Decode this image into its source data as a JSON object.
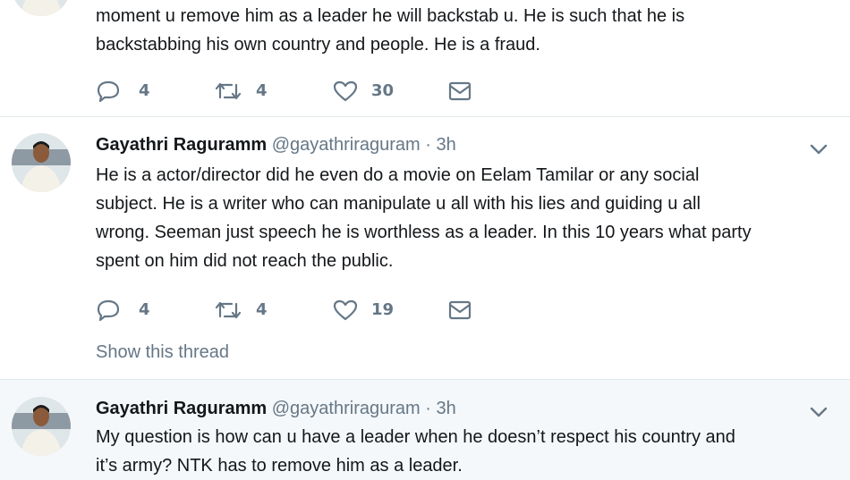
{
  "tweets": [
    {
      "text_lines": [
        "moment u remove him as a leader he will backstab u. He is such that he is",
        "backstabbing his own country and people. He is a fraud."
      ],
      "replies": "4",
      "retweets": "4",
      "likes": "30"
    },
    {
      "name": "Gayathri Raguramm",
      "handle": "@gayathriraguram",
      "separator": "·",
      "time": "3h",
      "text_lines": [
        "He is a actor/director did he even do a movie on Eelam Tamilar or any social",
        "subject. He is a writer who can manipulate u all with his lies and guiding u all",
        "wrong. Seeman just speech he is worthless as a leader. In this 10 years what party",
        "spent on him did not reach the public."
      ],
      "replies": "4",
      "retweets": "4",
      "likes": "19",
      "show_thread": "Show this thread"
    },
    {
      "name": "Gayathri Raguramm",
      "handle": "@gayathriraguram",
      "separator": "·",
      "time": "3h",
      "text_lines": [
        "My question is how can u have a leader when he doesn’t respect his country and",
        "it’s army? NTK has to remove him as a leader."
      ]
    }
  ],
  "icons": {
    "reply": "reply-icon",
    "retweet": "retweet-icon",
    "like": "heart-icon",
    "dm": "envelope-icon",
    "more": "chevron-down-icon"
  },
  "colors": {
    "text": "#14171a",
    "secondary": "#657786",
    "divider": "#e1e8ed",
    "highlight_bg": "#f5f8fa"
  }
}
